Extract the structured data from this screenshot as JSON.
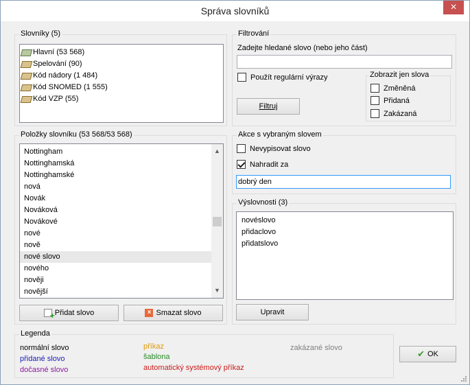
{
  "window": {
    "title": "Správa slovníků",
    "close": "×"
  },
  "dictionaries": {
    "label": "Slovníky (5)",
    "items": [
      {
        "label": "Hlavní (53 568)",
        "icon": "book-main-icon"
      },
      {
        "label": "Spelování (90)",
        "icon": "book-icon"
      },
      {
        "label": "Kód nádory (1 484)",
        "icon": "book-icon"
      },
      {
        "label": "Kód SNOMED (1 555)",
        "icon": "book-icon"
      },
      {
        "label": "Kód VZP (55)",
        "icon": "book-icon"
      }
    ]
  },
  "filter": {
    "label": "Filtrování",
    "prompt": "Zadejte hledané slovo (nebo jeho část)",
    "value": "",
    "regex_label": "Použít regulární výrazy",
    "regex_checked": false,
    "show_only_label": "Zobrazit jen slova",
    "changed_label": "Změněná",
    "added_label": "Přidaná",
    "forbidden_label": "Zakázaná",
    "button": "Filtruj"
  },
  "items": {
    "label": "Položky slovníku (53 568/53 568)",
    "rows": [
      "Nottingham",
      "Nottinghamská",
      "Nottinghamské",
      "nová",
      "Novák",
      "Nováková",
      "Novákové",
      "nové",
      "nově",
      "nové slovo",
      "nového",
      "nověji",
      "novější"
    ],
    "selected_index": 9,
    "add_button": "Přidat slovo",
    "delete_button": "Smazat slovo"
  },
  "actions": {
    "label": "Akce s vybraným slovem",
    "no_write_label": "Nevypisovat slovo",
    "no_write_checked": false,
    "replace_label": "Nahradit za",
    "replace_checked": true,
    "replace_value": "dobrý den"
  },
  "pronunciations": {
    "label": "Výslovnosti (3)",
    "items": [
      "novéslovo",
      "přidaclovo",
      "přidatslovo"
    ],
    "edit_button": "Upravit"
  },
  "legend": {
    "label": "Legenda",
    "normal": "normální slovo",
    "added": "přidané slovo",
    "temporary": "dočasné slovo",
    "command": "příkaz",
    "template": "šablona",
    "auto_command": "automatický systémový příkaz",
    "forbidden": "zakázané slovo",
    "colors": {
      "normal": "#000000",
      "added": "#1a1ab4",
      "temporary": "#8a1a9e",
      "command": "#e09a00",
      "template": "#2a8a2a",
      "auto_command": "#cc1a1a",
      "forbidden": "#808080"
    }
  },
  "ok_button": "OK"
}
